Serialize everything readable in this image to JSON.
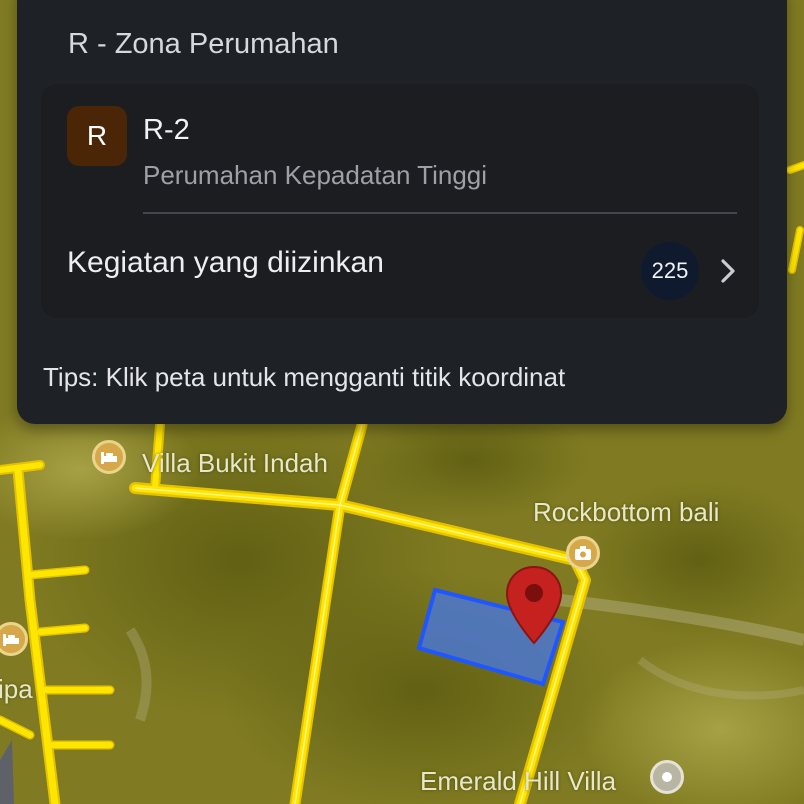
{
  "zone_card": {
    "title": "R - Zona Perumahan",
    "badge_letter": "R",
    "code": "R-2",
    "description": "Perumahan Kepadatan Tinggi",
    "activities_label": "Kegiatan yang diizinkan",
    "activities_count": "225",
    "tips": "Tips: Klik peta untuk mengganti titik koordinat"
  },
  "map": {
    "labels": {
      "villa": "Villa Bukit Indah",
      "rockbottom": "Rockbottom bali",
      "emerald": "Emerald Hill Villa",
      "partial_left": "ipa"
    },
    "icons": {
      "hotel": "hotel-icon",
      "camera": "camera-icon",
      "marker": "map-pin-icon"
    },
    "colors": {
      "overlay": "#c9be2a",
      "road": "#ffe600",
      "parcel_fill": "#4b77d1",
      "parcel_stroke": "#1f56ff",
      "pin": "#c5221f",
      "badge_bg": "#4b2606"
    }
  }
}
